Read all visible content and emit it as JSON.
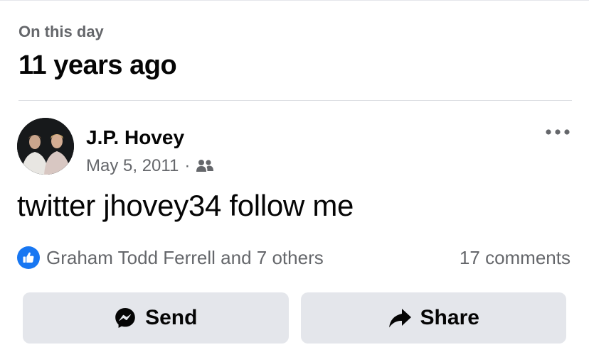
{
  "memories": {
    "eyebrow": "On this day",
    "headline": "11 years ago"
  },
  "post": {
    "author": "J.P. Hovey",
    "date": "May 5, 2011",
    "separator": "·",
    "audience_icon": "friends-icon",
    "more_icon": "more-options-icon",
    "text": "twitter jhovey34 follow me",
    "reactions": {
      "icon": "like-icon",
      "summary": "Graham Todd Ferrell and 7 others"
    },
    "comments": "17 comments"
  },
  "actions": {
    "send": {
      "label": "Send",
      "icon": "messenger-icon"
    },
    "share": {
      "label": "Share",
      "icon": "share-arrow-icon"
    }
  },
  "colors": {
    "like_blue": "#1877f2",
    "secondary_text": "#65676b",
    "button_bg": "#e4e6eb"
  }
}
